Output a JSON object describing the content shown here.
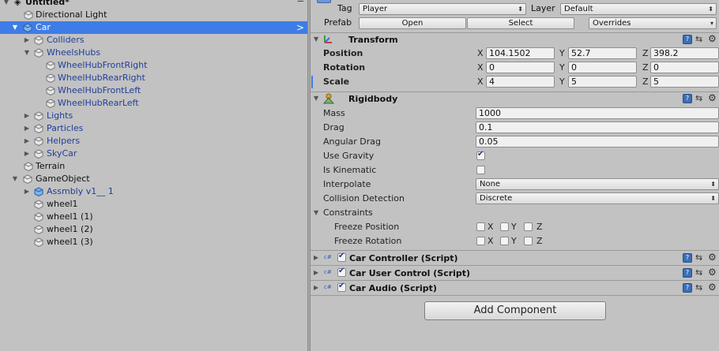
{
  "hierarchy": {
    "scene_name": "Untitled*",
    "scene_menu_icon": "menu-icon",
    "items": [
      {
        "label": "Directional Light"
      },
      {
        "label": "Car"
      },
      {
        "label": "Colliders"
      },
      {
        "label": "WheelsHubs"
      },
      {
        "label": "WheelHubFrontRight"
      },
      {
        "label": "WheelHubRearRight"
      },
      {
        "label": "WheelHubFrontLeft"
      },
      {
        "label": "WheelHubRearLeft"
      },
      {
        "label": "Lights"
      },
      {
        "label": "Particles"
      },
      {
        "label": "Helpers"
      },
      {
        "label": "SkyCar"
      },
      {
        "label": "Terrain"
      },
      {
        "label": "GameObject"
      },
      {
        "label": "Assmbly v1__ 1"
      },
      {
        "label": "wheel1"
      },
      {
        "label": "wheel1 (1)"
      },
      {
        "label": "wheel1 (2)"
      },
      {
        "label": "wheel1 (3)"
      }
    ],
    "selected_chevron": ">"
  },
  "inspector": {
    "tag_label": "Tag",
    "tag_value": "Player",
    "layer_label": "Layer",
    "layer_value": "Default",
    "prefab_label": "Prefab",
    "open_label": "Open",
    "select_label": "Select",
    "overrides_label": "Overrides",
    "transform": {
      "title": "Transform",
      "position_label": "Position",
      "rotation_label": "Rotation",
      "scale_label": "Scale",
      "x": "X",
      "y": "Y",
      "z": "Z",
      "position": {
        "x": "104.1502",
        "y": "52.7",
        "z": "398.2"
      },
      "rotation": {
        "x": "0",
        "y": "0",
        "z": "0"
      },
      "scale": {
        "x": "4",
        "y": "5",
        "z": "5"
      }
    },
    "rigidbody": {
      "title": "Rigidbody",
      "mass_label": "Mass",
      "mass": "1000",
      "drag_label": "Drag",
      "drag": "0.1",
      "angular_drag_label": "Angular Drag",
      "angular_drag": "0.05",
      "use_gravity_label": "Use Gravity",
      "use_gravity": true,
      "is_kinematic_label": "Is Kinematic",
      "is_kinematic": false,
      "interpolate_label": "Interpolate",
      "interpolate": "None",
      "collision_label": "Collision Detection",
      "collision": "Discrete",
      "constraints_label": "Constraints",
      "freeze_position_label": "Freeze Position",
      "freeze_rotation_label": "Freeze Rotation",
      "x": "X",
      "y": "Y",
      "z": "Z"
    },
    "scripts": [
      {
        "title": "Car Controller (Script)"
      },
      {
        "title": "Car User Control (Script)"
      },
      {
        "title": "Car Audio (Script)"
      }
    ],
    "add_component_label": "Add Component"
  },
  "colors": {
    "selection": "#3e7de7",
    "panel": "#c2c2c2",
    "link_blue": "#1f3f9a"
  }
}
